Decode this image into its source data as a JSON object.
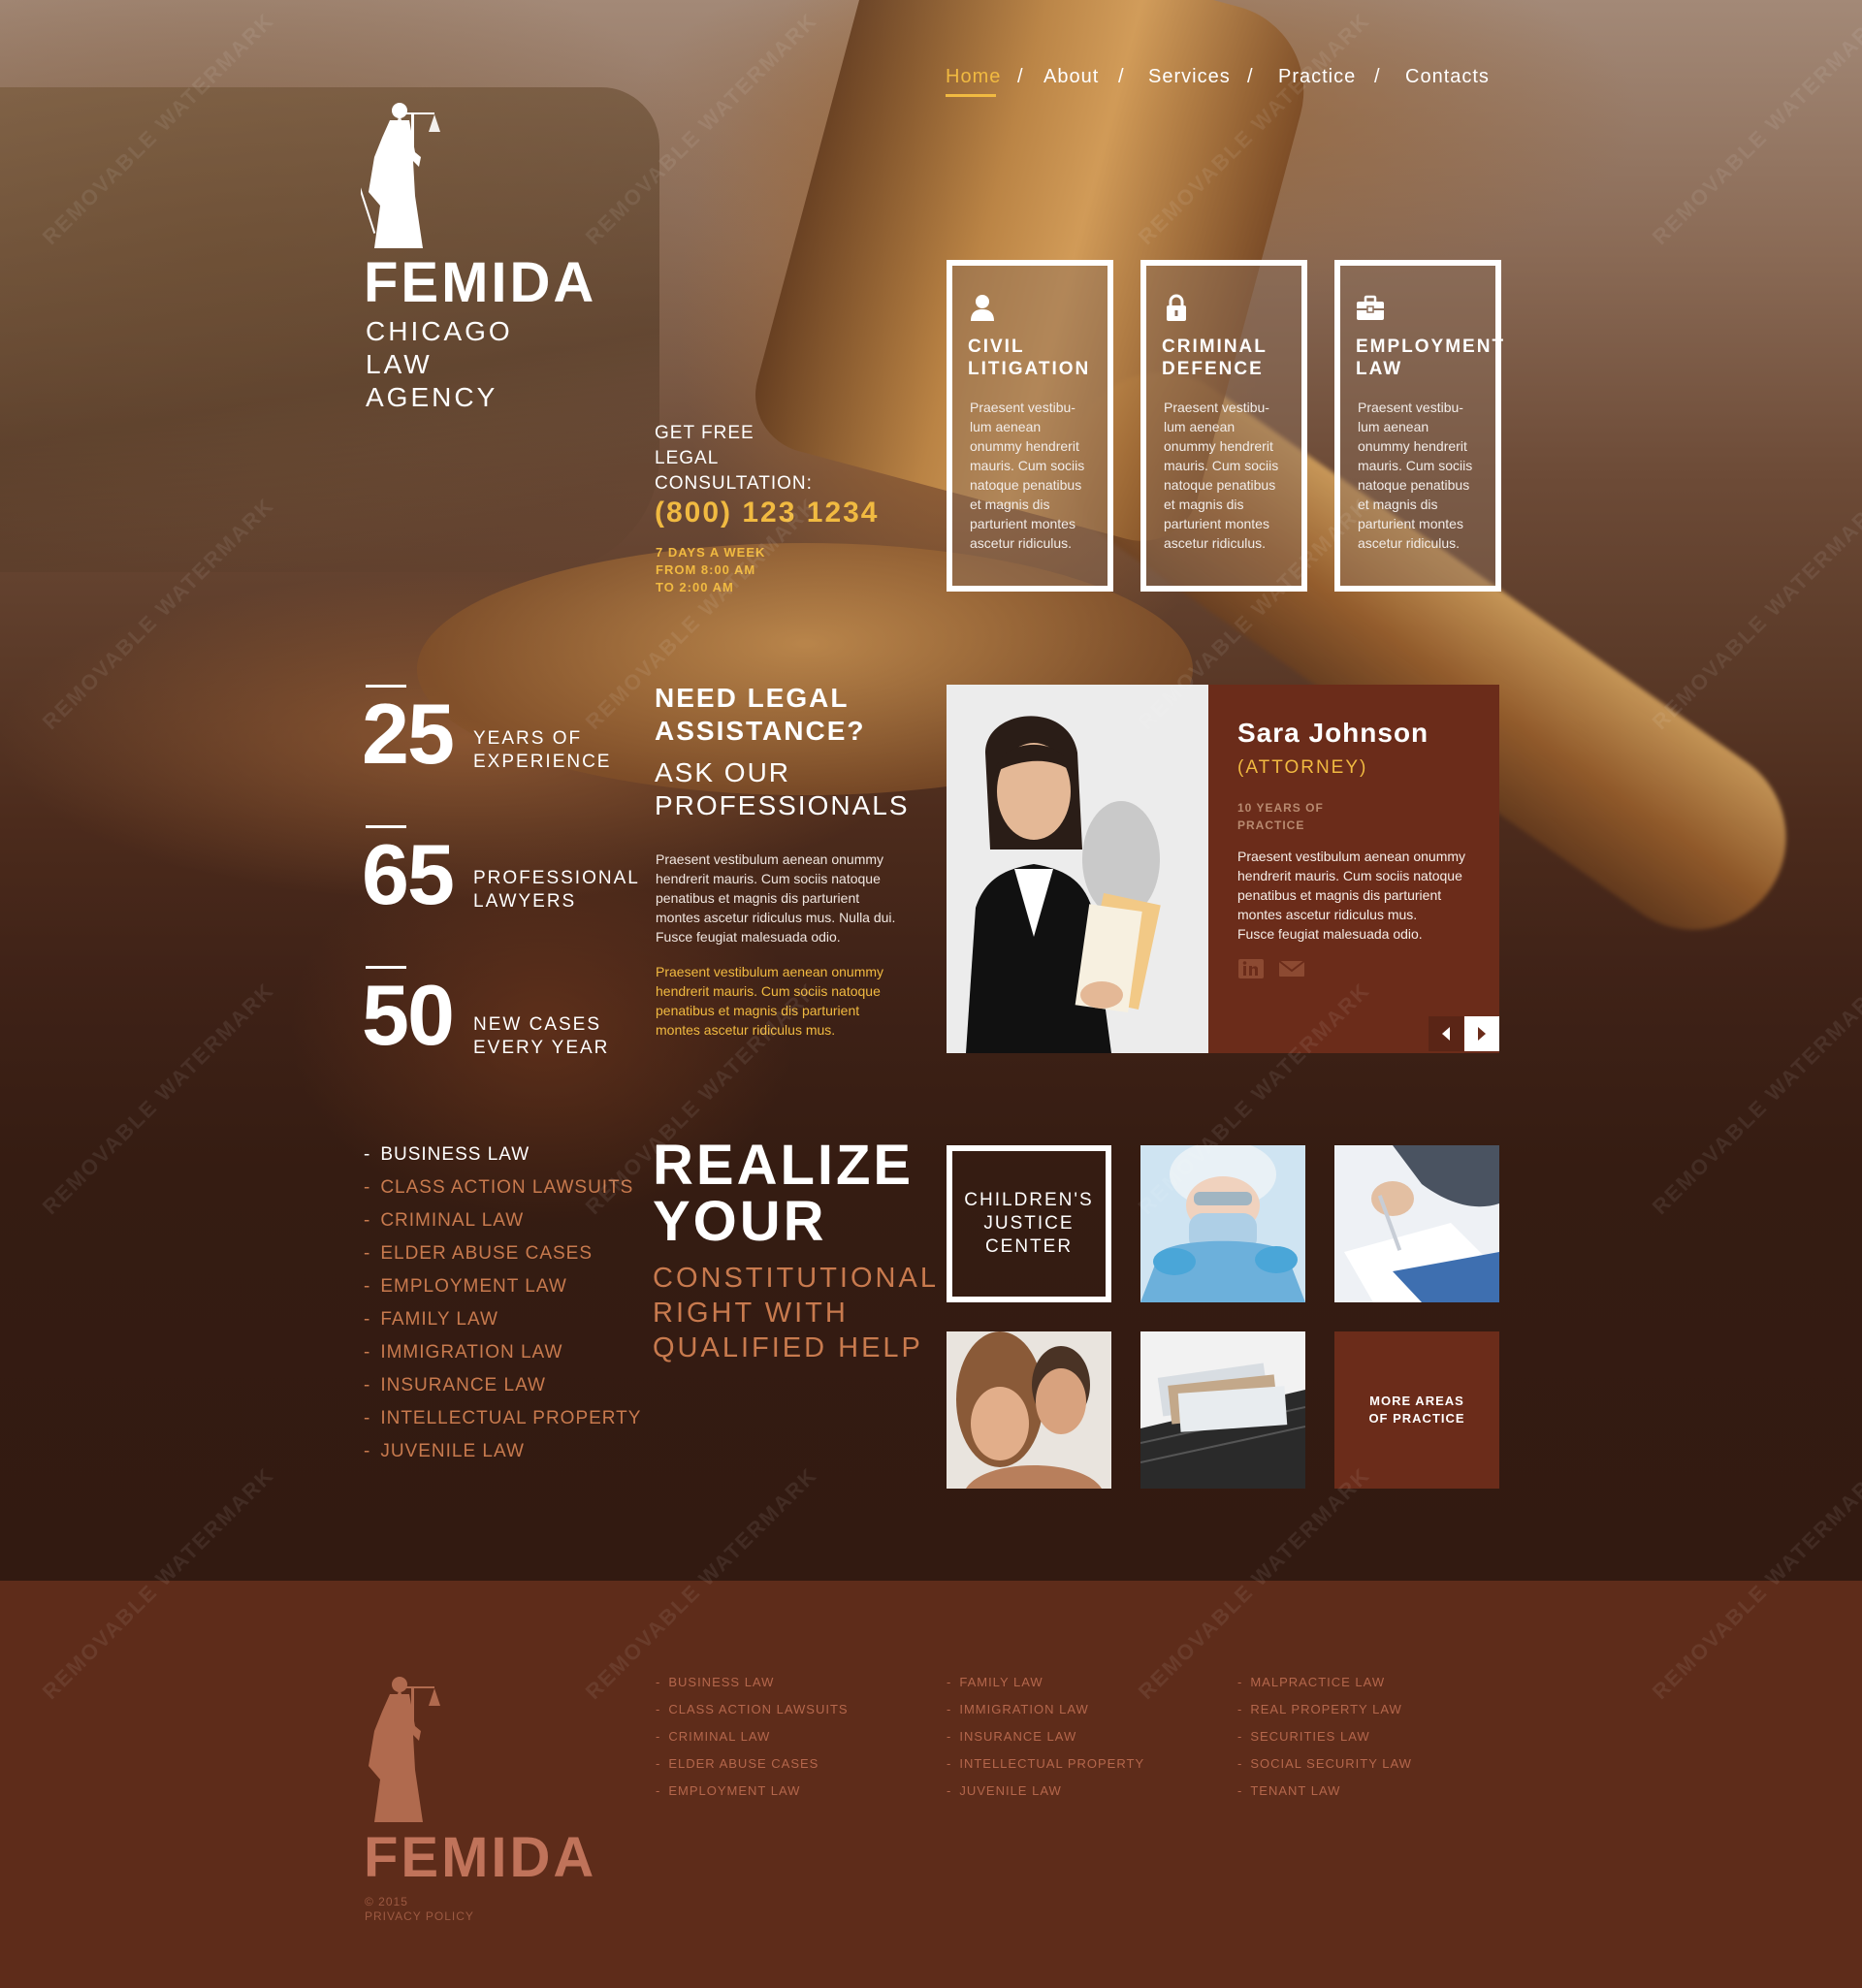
{
  "nav": {
    "items": [
      {
        "label": "Home"
      },
      {
        "label": "About"
      },
      {
        "label": "Services"
      },
      {
        "label": "Practice"
      },
      {
        "label": "Contacts"
      }
    ],
    "separator": "/"
  },
  "logo": {
    "name": "FEMIDA",
    "sub": [
      "CHICAGO",
      "LAW",
      "AGENCY"
    ]
  },
  "consultation": {
    "lines": [
      "GET FREE",
      "LEGAL",
      "CONSULTATION:"
    ],
    "phone": "(800) 123 1234",
    "hours": [
      "7 DAYS A WEEK",
      "FROM 8:00 AM",
      "TO 2:00 AM"
    ]
  },
  "services": [
    {
      "title": "CIVIL\nLITIGATION",
      "icon": "person-icon",
      "text": "Praesent vestibu-\nlum aenean\nonummy hendrerit\nmauris. Cum sociis\nnatoque penatibus\net magnis dis\nparturient montes\nascetur ridiculus."
    },
    {
      "title": "CRIMINAL\nDEFENCE",
      "icon": "lock-icon",
      "text": "Praesent vestibu-\nlum aenean\nonummy hendrerit\nmauris. Cum sociis\nnatoque penatibus\net magnis dis\nparturient montes\nascetur ridiculus."
    },
    {
      "title": "EMPLOYMENT\nLAW",
      "icon": "briefcase-icon",
      "text": "Praesent vestibu-\nlum aenean\nonummy hendrerit\nmauris. Cum sociis\nnatoque penatibus\net magnis dis\nparturient montes\nascetur ridiculus."
    }
  ],
  "stats": [
    {
      "number": "25",
      "label": "YEARS OF\nEXPERIENCE"
    },
    {
      "number": "65",
      "label": "PROFESSIONAL\nLAWYERS"
    },
    {
      "number": "50",
      "label": "NEW CASES\nEVERY YEAR"
    }
  ],
  "assistance": {
    "title": "NEED LEGAL\nASSISTANCE?",
    "subtitle": "ASK OUR\nPROFESSIONALS",
    "text1": "Praesent vestibulum aenean onummy\nhendrerit mauris. Cum sociis natoque\npenatibus et magnis dis parturient\nmontes ascetur ridiculus mus. Nulla dui.\nFusce feugiat malesuada odio.",
    "text2": "Praesent vestibulum aenean onummy\nhendrerit mauris. Cum sociis natoque\npenatibus et magnis dis parturient\nmontes ascetur ridiculus mus."
  },
  "attorney": {
    "name": "Sara Johnson",
    "role": "(ATTORNEY)",
    "experience": "10 YEARS OF\nPRACTICE",
    "bio": "Praesent vestibulum aenean onummy\nhendrerit mauris. Cum sociis natoque\npenatibus et magnis dis parturient\nmontes ascetur ridiculus mus.\nFusce feugiat malesuada odio."
  },
  "practice_areas": [
    "BUSINESS LAW",
    "CLASS ACTION LAWSUITS",
    "CRIMINAL LAW",
    "ELDER ABUSE CASES",
    "EMPLOYMENT LAW",
    "FAMILY LAW",
    "IMMIGRATION LAW",
    "INSURANCE LAW",
    "INTELLECTUAL PROPERTY",
    "JUVENILE LAW"
  ],
  "realize": {
    "title": "REALIZE\nYOUR",
    "subtitle": "CONSTITUTIONAL\nRIGHT WITH\nQUALIFIED HELP"
  },
  "grid": {
    "children_tile": "CHILDREN'S\nJUSTICE\nCENTER",
    "more_tile": "MORE AREAS\nOF PRACTICE"
  },
  "footer": {
    "logo_name": "FEMIDA",
    "copyright": "© 2015",
    "privacy": "PRIVACY POLICY",
    "columns": [
      [
        "BUSINESS LAW",
        "CLASS ACTION LAWSUITS",
        "CRIMINAL LAW",
        "ELDER ABUSE CASES",
        "EMPLOYMENT LAW"
      ],
      [
        "FAMILY LAW",
        "IMMIGRATION LAW",
        "INSURANCE LAW",
        "INTELLECTUAL PROPERTY",
        "JUVENILE LAW"
      ],
      [
        "MALPRACTICE LAW",
        "REAL PROPERTY LAW",
        "SECURITIES LAW",
        "SOCIAL SECURITY LAW",
        "TENANT LAW"
      ]
    ]
  },
  "watermark": "REMOVABLE WATERMARK",
  "colors": {
    "accent": "#f1ba41",
    "panel": "#6b2c1a",
    "footer": "#5e2c1a",
    "practice_link": "#c87a4e"
  }
}
